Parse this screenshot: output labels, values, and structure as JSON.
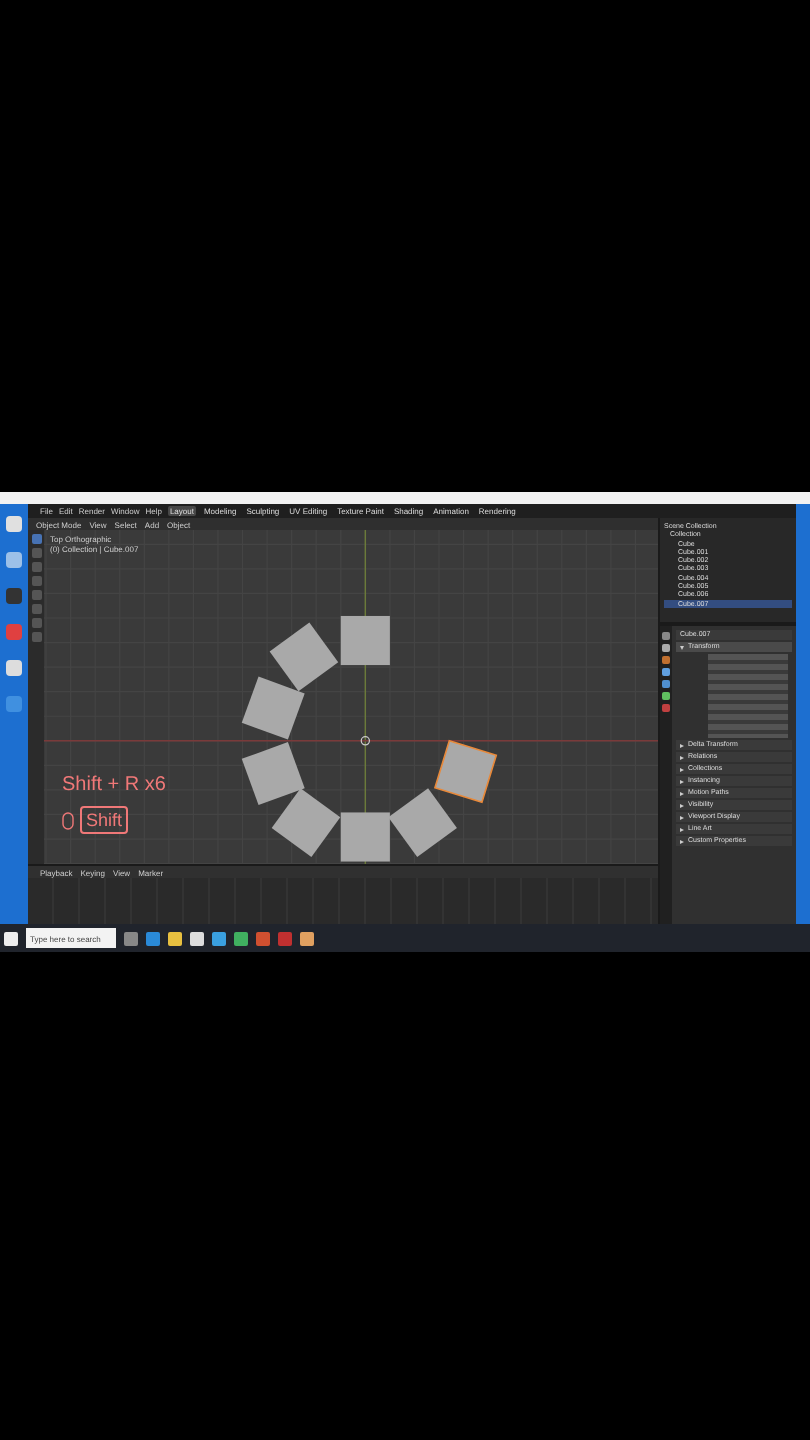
{
  "menu_bar": {
    "items": [
      "File",
      "Edit",
      "Render",
      "Window",
      "Help"
    ]
  },
  "workspace_tabs": [
    {
      "label": "Layout",
      "selected": true
    },
    {
      "label": "Modeling",
      "selected": false
    },
    {
      "label": "Sculpting",
      "selected": false
    },
    {
      "label": "UV Editing",
      "selected": false
    },
    {
      "label": "Texture Paint",
      "selected": false
    },
    {
      "label": "Shading",
      "selected": false
    },
    {
      "label": "Animation",
      "selected": false
    },
    {
      "label": "Rendering",
      "selected": false
    }
  ],
  "viewport": {
    "header_items": [
      "Object Mode",
      "View",
      "Select",
      "Add",
      "Object"
    ],
    "overlay_lines": [
      "Top Orthographic",
      "(0) Collection | Cube.007"
    ],
    "caption": "Shift + R x6",
    "key": "Shift"
  },
  "outliner": {
    "title": "Scene Collection",
    "items": [
      {
        "label": "Collection",
        "selected": false
      },
      {
        "label": "Cube",
        "selected": false
      },
      {
        "label": "Cube.001",
        "selected": false
      },
      {
        "label": "Cube.002",
        "selected": false
      },
      {
        "label": "Cube.003",
        "selected": false
      },
      {
        "label": "Cube.004",
        "selected": false
      },
      {
        "label": "Cube.005",
        "selected": false
      },
      {
        "label": "Cube.006",
        "selected": false
      },
      {
        "label": "Cube.007",
        "selected": true
      }
    ]
  },
  "properties": {
    "object_name": "Cube.007",
    "sections": [
      {
        "label": "Transform",
        "expanded": true
      },
      {
        "label": "Delta Transform",
        "expanded": false
      },
      {
        "label": "Relations",
        "expanded": false
      },
      {
        "label": "Collections",
        "expanded": false
      },
      {
        "label": "Instancing",
        "expanded": false
      },
      {
        "label": "Motion Paths",
        "expanded": false
      },
      {
        "label": "Visibility",
        "expanded": false
      },
      {
        "label": "Viewport Display",
        "expanded": false
      },
      {
        "label": "Line Art",
        "expanded": false
      },
      {
        "label": "Custom Properties",
        "expanded": false
      }
    ]
  },
  "timeline": {
    "menu": [
      "Playback",
      "Keying",
      "View",
      "Marker"
    ]
  },
  "taskbar": {
    "search": {
      "placeholder": "Type here to search"
    }
  }
}
